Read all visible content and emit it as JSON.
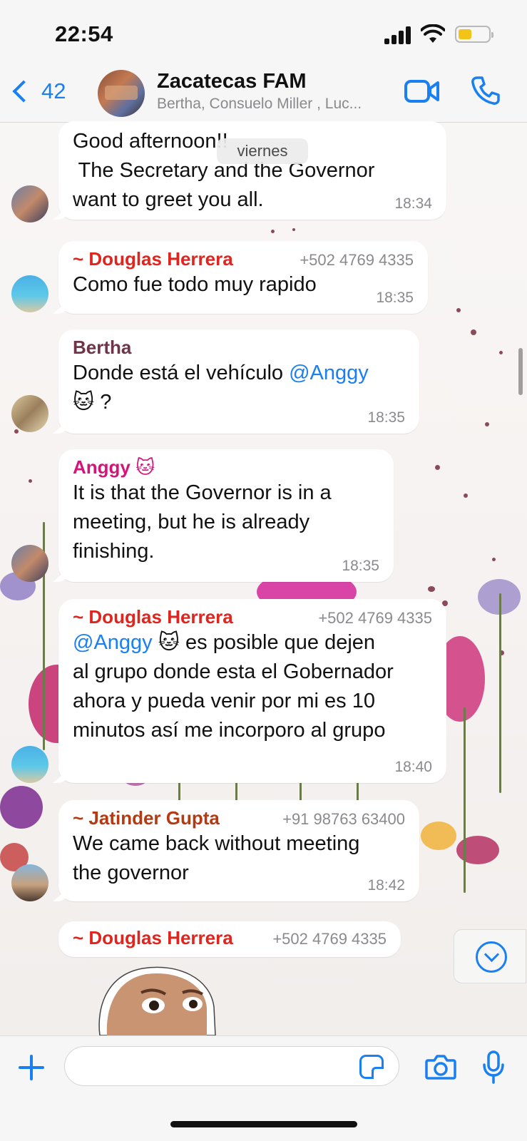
{
  "status_bar": {
    "time": "22:54"
  },
  "header": {
    "back_count": "42",
    "title": "Zacatecas FAM",
    "subtitle": "Bertha, Consuelo Miller , Luc..."
  },
  "day_divider": "viernes",
  "messages": [
    {
      "sender": "",
      "phone": "",
      "text_lines": [
        "Good afternoon!!",
        " The Secretary and the Governor",
        "want to greet you all."
      ],
      "time": "18:34"
    },
    {
      "sender": "~ Douglas Herrera",
      "phone": "+502 4769 4335",
      "text_lines": [
        "Como fue todo muy rapido"
      ],
      "time": "18:35"
    },
    {
      "sender": "Bertha",
      "phone": "",
      "text_pre": "Donde está el vehículo ",
      "mention": "@Anggy",
      "text_post": "🐱 ?",
      "time": "18:35"
    },
    {
      "sender": "Anggy 🐱",
      "phone": "",
      "text_lines": [
        "It is that the Governor is in a",
        "meeting, but he is already",
        "finishing."
      ],
      "time": "18:35"
    },
    {
      "sender": "~ Douglas Herrera",
      "phone": "+502 4769 4335",
      "mention": "@Anggy",
      "text_post": " 🐱 es posible que dejen",
      "text_lines": [
        "al grupo donde esta el Gobernador",
        "ahora y pueda venir por mi es 10",
        "minutos así me incorporo al grupo"
      ],
      "time": "18:40"
    },
    {
      "sender": "~ Jatinder Gupta",
      "phone": "+91 98763 63400",
      "text_lines": [
        "We came back without meeting",
        "the governor"
      ],
      "time": "18:42"
    },
    {
      "sender": "~ Douglas Herrera",
      "phone": "+502 4769 4335"
    }
  ],
  "colors": {
    "accent": "#1a7ff0",
    "douglas": "#e0251f",
    "bertha": "#6e3448",
    "anggy": "#d4147a",
    "jatinder": "#b33a12"
  },
  "input": {
    "placeholder": ""
  },
  "icons": [
    "video-call-icon",
    "phone-call-icon",
    "plus-icon",
    "sticker-icon",
    "camera-icon",
    "mic-icon",
    "scroll-down-icon",
    "back-chevron-icon"
  ]
}
